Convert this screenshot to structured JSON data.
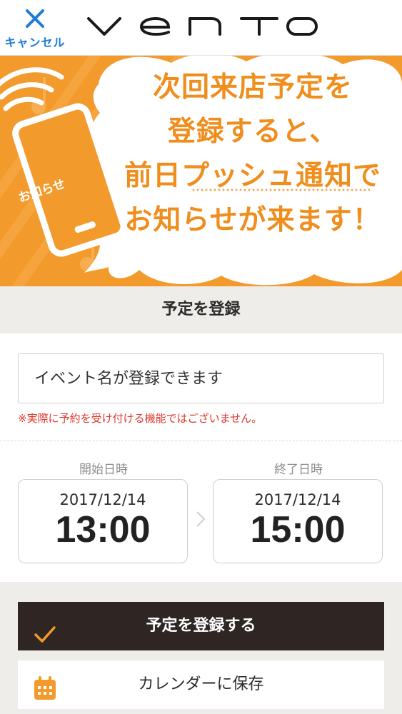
{
  "header": {
    "cancel_label": "キャンセル",
    "brand": "VENTO"
  },
  "banner": {
    "lines": [
      "次回来店予定を",
      "登録すると、",
      "前日プッシュ通知で",
      "お知らせが来ます！"
    ],
    "phone_label": "お知らせ"
  },
  "section": {
    "title": "予定を登録"
  },
  "form": {
    "event_placeholder": "イベント名が登録できます",
    "notice": "※実際に予約を受け付ける機能ではございません。",
    "start": {
      "label": "開始日時",
      "date": "2017/12/14",
      "time": "13:00"
    },
    "end": {
      "label": "終了日時",
      "date": "2017/12/14",
      "time": "15:00"
    }
  },
  "actions": {
    "register_label": "予定を登録する",
    "calendar_label": "カレンダーに保存"
  },
  "colors": {
    "accent": "#f39a2c",
    "link": "#1f7cd6",
    "notice": "#e0362b",
    "primary_button": "#2f2523"
  },
  "icons": {
    "cancel": "close-icon",
    "register": "check-icon",
    "calendar": "calendar-icon",
    "arrow": "chevron-right-icon"
  }
}
